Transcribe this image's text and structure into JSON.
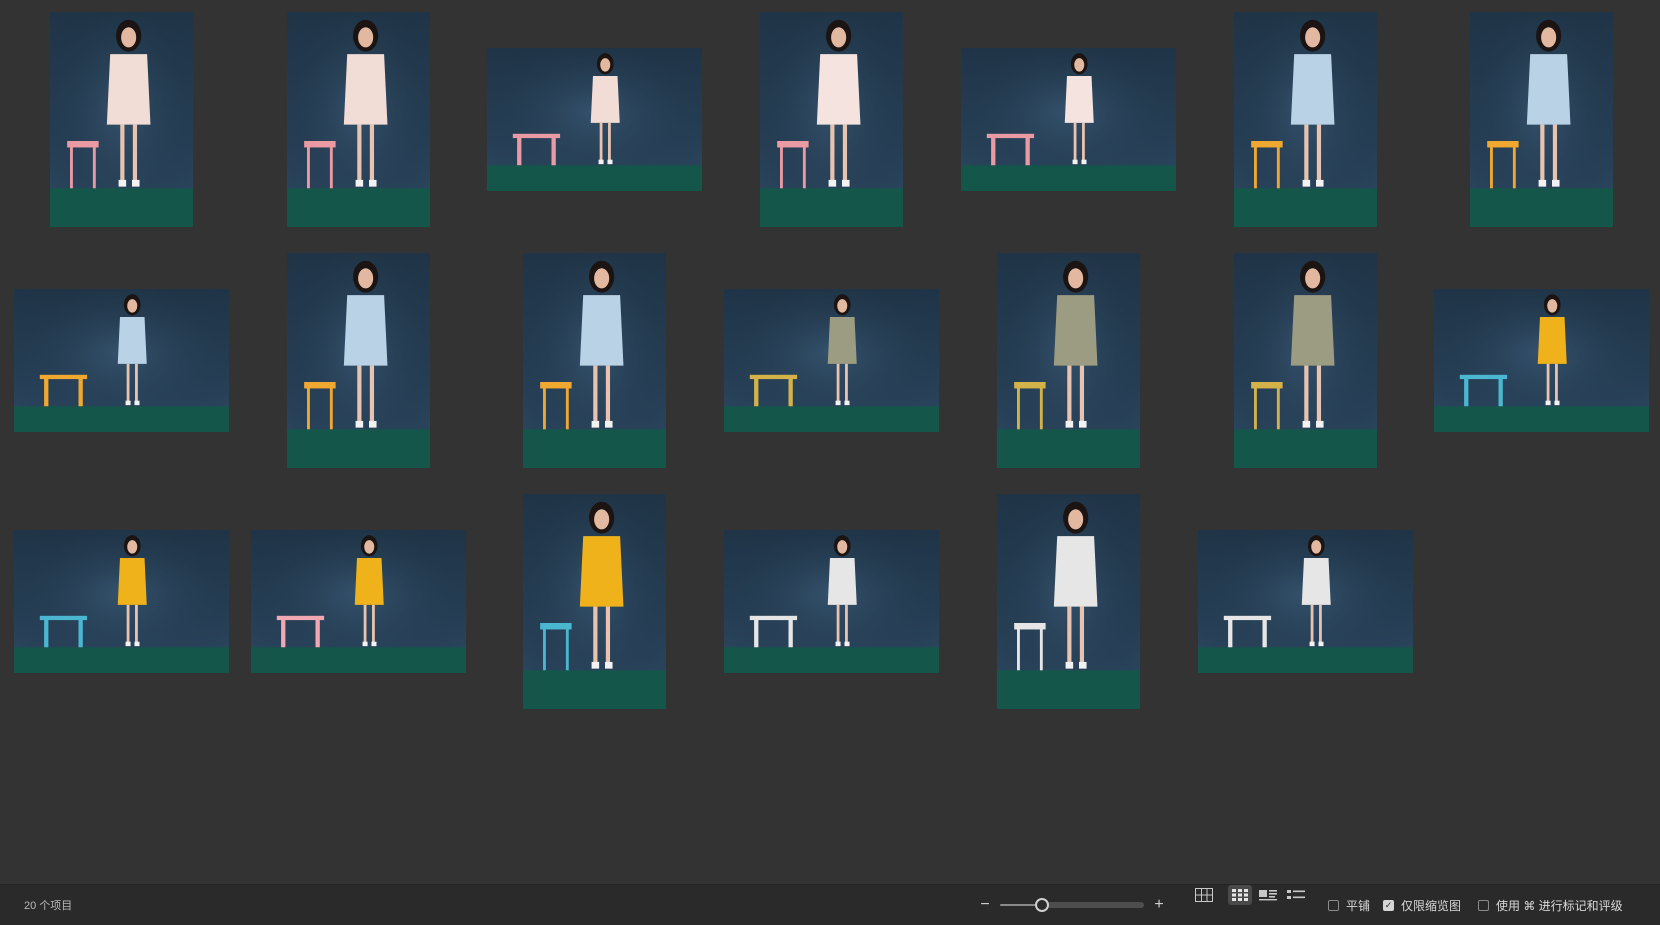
{
  "status": {
    "item_count": "20 个项目",
    "zoom_out": "−",
    "zoom_in": "+",
    "zoom_level": 0.28,
    "options": {
      "tile": {
        "label": "平铺",
        "checked": false
      },
      "thumbs_only": {
        "label": "仅限缩览图",
        "checked": true
      },
      "use_cmd": {
        "label": "使用 ⌘ 进行标记和评级",
        "checked": false
      }
    },
    "views": [
      "grid-large-icon",
      "grid-small-icon",
      "filmstrip-icon",
      "list-icon"
    ],
    "active_view": "grid-small-icon"
  },
  "thumbnails": [
    {
      "id": 1,
      "orientation": "portrait",
      "outfit": "#f2dcd6",
      "prop": "#e99aa3",
      "floor": "#14564a"
    },
    {
      "id": 2,
      "orientation": "portrait",
      "outfit": "#f2dcd6",
      "prop": "#e99aa3",
      "floor": "#14564a"
    },
    {
      "id": 3,
      "orientation": "landscape",
      "outfit": "#f2dcd6",
      "prop": "#e99aa3",
      "floor": "#14564a"
    },
    {
      "id": 4,
      "orientation": "portrait",
      "outfit": "#f4e3df",
      "prop": "#e99aa3",
      "floor": "#14564a"
    },
    {
      "id": 5,
      "orientation": "landscape",
      "outfit": "#f4e3df",
      "prop": "#e99aa3",
      "floor": "#14564a"
    },
    {
      "id": 6,
      "orientation": "portrait",
      "outfit": "#b9d2e6",
      "prop": "#f0a830",
      "floor": "#14564a"
    },
    {
      "id": 7,
      "orientation": "portrait",
      "outfit": "#b9d2e6",
      "prop": "#f0a830",
      "floor": "#14564a"
    },
    {
      "id": 8,
      "orientation": "landscape",
      "outfit": "#b9d2e6",
      "prop": "#f0a830",
      "floor": "#14564a"
    },
    {
      "id": 9,
      "orientation": "portrait",
      "outfit": "#b9d2e6",
      "prop": "#f0a830",
      "floor": "#14564a"
    },
    {
      "id": 10,
      "orientation": "portrait",
      "outfit": "#b9d2e6",
      "prop": "#f0a830",
      "floor": "#14564a"
    },
    {
      "id": 11,
      "orientation": "landscape",
      "outfit": "#9c9c82",
      "prop": "#d4b24a",
      "floor": "#14564a"
    },
    {
      "id": 12,
      "orientation": "portrait",
      "outfit": "#9c9c82",
      "prop": "#d4b24a",
      "floor": "#14564a"
    },
    {
      "id": 13,
      "orientation": "portrait",
      "outfit": "#9c9c82",
      "prop": "#d4b24a",
      "floor": "#14564a"
    },
    {
      "id": 14,
      "orientation": "landscape",
      "outfit": "#f0b21a",
      "prop": "#4bb6cf",
      "floor": "#14564a"
    },
    {
      "id": 15,
      "orientation": "landscape",
      "outfit": "#f0b21a",
      "prop": "#4bb6cf",
      "floor": "#14564a"
    },
    {
      "id": 16,
      "orientation": "landscape",
      "outfit": "#f0b21a",
      "prop": "#f1a8b2",
      "floor": "#14564a"
    },
    {
      "id": 17,
      "orientation": "portrait",
      "outfit": "#f0b21a",
      "prop": "#4bb6cf",
      "floor": "#14564a"
    },
    {
      "id": 18,
      "orientation": "landscape",
      "outfit": "#e6e6e6",
      "prop": "#e6e6e6",
      "floor": "#14564a"
    },
    {
      "id": 19,
      "orientation": "portrait",
      "outfit": "#e6e6e6",
      "prop": "#e6e6e6",
      "floor": "#14564a"
    },
    {
      "id": 20,
      "orientation": "landscape",
      "outfit": "#e6e6e6",
      "prop": "#e6e6e6",
      "floor": "#14564a"
    }
  ]
}
